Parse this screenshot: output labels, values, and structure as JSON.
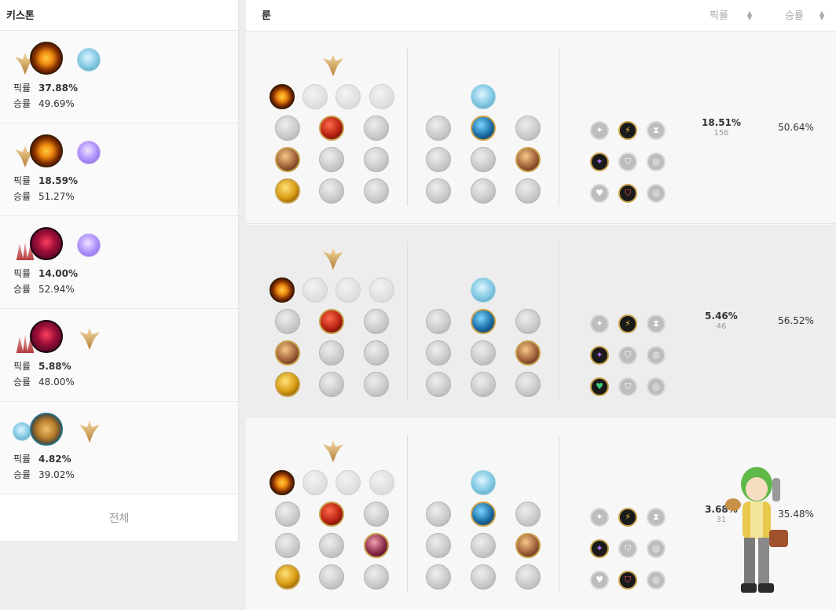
{
  "left_panel": {
    "title": "키스톤",
    "pick_label": "픽률",
    "win_label": "승률",
    "keystones": [
      {
        "pick": "37.88%",
        "win": "49.69%",
        "main_icon": "keystone-sun-icon",
        "secondary_icon": "tree-blue-icon"
      },
      {
        "pick": "18.59%",
        "win": "51.27%",
        "main_icon": "keystone-sun-icon",
        "secondary_icon": "tree-purple-icon"
      },
      {
        "pick": "14.00%",
        "win": "52.94%",
        "main_icon": "keystone-dark-icon",
        "secondary_icon": "tree-purple-icon"
      },
      {
        "pick": "5.88%",
        "win": "48.00%",
        "main_icon": "keystone-dark-icon",
        "secondary_icon": "tree-gold-icon"
      },
      {
        "pick": "4.82%",
        "win": "39.02%",
        "main_icon": "keystone-coin-icon",
        "secondary_icon": "tree-gold-icon"
      }
    ],
    "all_label": "전체"
  },
  "right_panel": {
    "header": {
      "rune": "룬",
      "pick": "픽률",
      "win": "승률"
    },
    "builds": [
      {
        "pick": "18.51%",
        "count": "156",
        "win": "50.64%"
      },
      {
        "pick": "5.46%",
        "count": "46",
        "win": "56.52%"
      },
      {
        "pick": "3.68%",
        "count": "31",
        "win": "35.48%"
      }
    ]
  },
  "colors": {
    "accent_gold": "#c8a14b",
    "panel_bg": "#ffffff",
    "alt_row_bg": "#ededed"
  }
}
